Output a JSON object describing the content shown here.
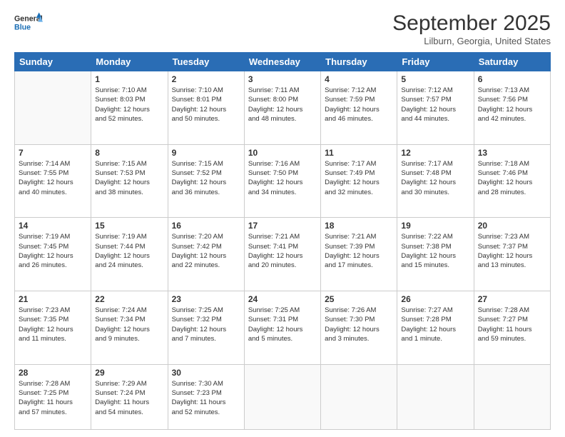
{
  "logo": {
    "general": "General",
    "blue": "Blue"
  },
  "title": "September 2025",
  "location": "Lilburn, Georgia, United States",
  "days_of_week": [
    "Sunday",
    "Monday",
    "Tuesday",
    "Wednesday",
    "Thursday",
    "Friday",
    "Saturday"
  ],
  "weeks": [
    [
      {
        "day": "",
        "info": ""
      },
      {
        "day": "1",
        "info": "Sunrise: 7:10 AM\nSunset: 8:03 PM\nDaylight: 12 hours\nand 52 minutes."
      },
      {
        "day": "2",
        "info": "Sunrise: 7:10 AM\nSunset: 8:01 PM\nDaylight: 12 hours\nand 50 minutes."
      },
      {
        "day": "3",
        "info": "Sunrise: 7:11 AM\nSunset: 8:00 PM\nDaylight: 12 hours\nand 48 minutes."
      },
      {
        "day": "4",
        "info": "Sunrise: 7:12 AM\nSunset: 7:59 PM\nDaylight: 12 hours\nand 46 minutes."
      },
      {
        "day": "5",
        "info": "Sunrise: 7:12 AM\nSunset: 7:57 PM\nDaylight: 12 hours\nand 44 minutes."
      },
      {
        "day": "6",
        "info": "Sunrise: 7:13 AM\nSunset: 7:56 PM\nDaylight: 12 hours\nand 42 minutes."
      }
    ],
    [
      {
        "day": "7",
        "info": "Sunrise: 7:14 AM\nSunset: 7:55 PM\nDaylight: 12 hours\nand 40 minutes."
      },
      {
        "day": "8",
        "info": "Sunrise: 7:15 AM\nSunset: 7:53 PM\nDaylight: 12 hours\nand 38 minutes."
      },
      {
        "day": "9",
        "info": "Sunrise: 7:15 AM\nSunset: 7:52 PM\nDaylight: 12 hours\nand 36 minutes."
      },
      {
        "day": "10",
        "info": "Sunrise: 7:16 AM\nSunset: 7:50 PM\nDaylight: 12 hours\nand 34 minutes."
      },
      {
        "day": "11",
        "info": "Sunrise: 7:17 AM\nSunset: 7:49 PM\nDaylight: 12 hours\nand 32 minutes."
      },
      {
        "day": "12",
        "info": "Sunrise: 7:17 AM\nSunset: 7:48 PM\nDaylight: 12 hours\nand 30 minutes."
      },
      {
        "day": "13",
        "info": "Sunrise: 7:18 AM\nSunset: 7:46 PM\nDaylight: 12 hours\nand 28 minutes."
      }
    ],
    [
      {
        "day": "14",
        "info": "Sunrise: 7:19 AM\nSunset: 7:45 PM\nDaylight: 12 hours\nand 26 minutes."
      },
      {
        "day": "15",
        "info": "Sunrise: 7:19 AM\nSunset: 7:44 PM\nDaylight: 12 hours\nand 24 minutes."
      },
      {
        "day": "16",
        "info": "Sunrise: 7:20 AM\nSunset: 7:42 PM\nDaylight: 12 hours\nand 22 minutes."
      },
      {
        "day": "17",
        "info": "Sunrise: 7:21 AM\nSunset: 7:41 PM\nDaylight: 12 hours\nand 20 minutes."
      },
      {
        "day": "18",
        "info": "Sunrise: 7:21 AM\nSunset: 7:39 PM\nDaylight: 12 hours\nand 17 minutes."
      },
      {
        "day": "19",
        "info": "Sunrise: 7:22 AM\nSunset: 7:38 PM\nDaylight: 12 hours\nand 15 minutes."
      },
      {
        "day": "20",
        "info": "Sunrise: 7:23 AM\nSunset: 7:37 PM\nDaylight: 12 hours\nand 13 minutes."
      }
    ],
    [
      {
        "day": "21",
        "info": "Sunrise: 7:23 AM\nSunset: 7:35 PM\nDaylight: 12 hours\nand 11 minutes."
      },
      {
        "day": "22",
        "info": "Sunrise: 7:24 AM\nSunset: 7:34 PM\nDaylight: 12 hours\nand 9 minutes."
      },
      {
        "day": "23",
        "info": "Sunrise: 7:25 AM\nSunset: 7:32 PM\nDaylight: 12 hours\nand 7 minutes."
      },
      {
        "day": "24",
        "info": "Sunrise: 7:25 AM\nSunset: 7:31 PM\nDaylight: 12 hours\nand 5 minutes."
      },
      {
        "day": "25",
        "info": "Sunrise: 7:26 AM\nSunset: 7:30 PM\nDaylight: 12 hours\nand 3 minutes."
      },
      {
        "day": "26",
        "info": "Sunrise: 7:27 AM\nSunset: 7:28 PM\nDaylight: 12 hours\nand 1 minute."
      },
      {
        "day": "27",
        "info": "Sunrise: 7:28 AM\nSunset: 7:27 PM\nDaylight: 11 hours\nand 59 minutes."
      }
    ],
    [
      {
        "day": "28",
        "info": "Sunrise: 7:28 AM\nSunset: 7:25 PM\nDaylight: 11 hours\nand 57 minutes."
      },
      {
        "day": "29",
        "info": "Sunrise: 7:29 AM\nSunset: 7:24 PM\nDaylight: 11 hours\nand 54 minutes."
      },
      {
        "day": "30",
        "info": "Sunrise: 7:30 AM\nSunset: 7:23 PM\nDaylight: 11 hours\nand 52 minutes."
      },
      {
        "day": "",
        "info": ""
      },
      {
        "day": "",
        "info": ""
      },
      {
        "day": "",
        "info": ""
      },
      {
        "day": "",
        "info": ""
      }
    ]
  ]
}
